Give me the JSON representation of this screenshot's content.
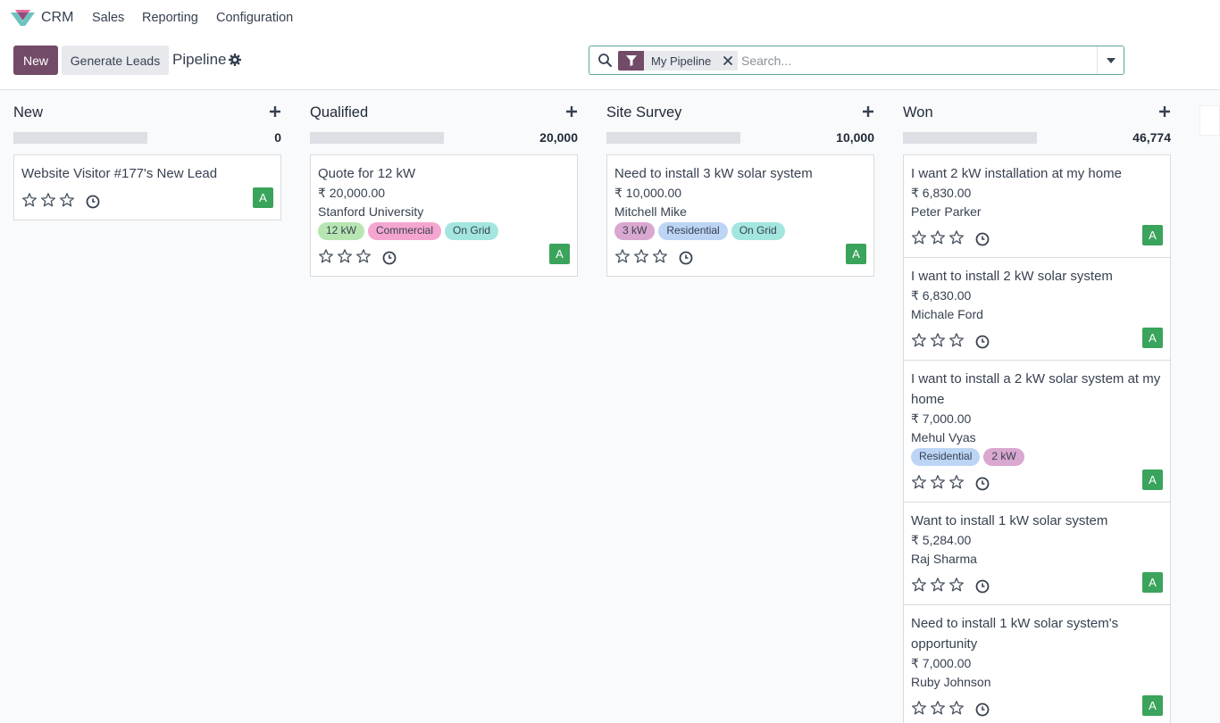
{
  "nav": {
    "app_name": "CRM",
    "menu": [
      "Sales",
      "Reporting",
      "Configuration"
    ]
  },
  "control": {
    "new_label": "New",
    "generate_label": "Generate Leads",
    "breadcrumb": "Pipeline",
    "search": {
      "facet": "My Pipeline",
      "placeholder": "Search..."
    }
  },
  "colors": {
    "brand": "#714B67",
    "avatar": "#3aa35c",
    "tag_green": "#b7e6b3",
    "tag_pink": "#f5a6d0",
    "tag_teal": "#a3e6df",
    "tag_purple": "#d9a7d0",
    "tag_blue": "#bdd5f5"
  },
  "columns": [
    {
      "title": "New",
      "total": "0",
      "cards": [
        {
          "title": "Website Visitor #177's New Lead",
          "amount": "",
          "customer": "",
          "tags": [],
          "avatar": "A"
        }
      ]
    },
    {
      "title": "Qualified",
      "total": "20,000",
      "cards": [
        {
          "title": "Quote for 12 kW",
          "amount": "₹ 20,000.00",
          "customer": "Stanford University",
          "tags": [
            {
              "label": "12 kW",
              "color": "#b7e6b3"
            },
            {
              "label": "Commercial",
              "color": "#f5a6d0"
            },
            {
              "label": "On Grid",
              "color": "#a3e6df"
            }
          ],
          "avatar": "A"
        }
      ]
    },
    {
      "title": "Site Survey",
      "total": "10,000",
      "cards": [
        {
          "title": "Need to install 3 kW solar system",
          "amount": "₹ 10,000.00",
          "customer": "Mitchell Mike",
          "tags": [
            {
              "label": "3 kW",
              "color": "#d9a7d0"
            },
            {
              "label": "Residential",
              "color": "#bdd5f5"
            },
            {
              "label": "On Grid",
              "color": "#a3e6df"
            }
          ],
          "avatar": "A"
        }
      ]
    },
    {
      "title": "Won",
      "total": "46,774",
      "cards": [
        {
          "title": "I want 2 kW installation at my home",
          "amount": "₹ 6,830.00",
          "customer": "Peter Parker",
          "tags": [],
          "avatar": "A"
        },
        {
          "title": "I want to install 2 kW solar system",
          "amount": "₹ 6,830.00",
          "customer": "Michale Ford",
          "tags": [],
          "avatar": "A"
        },
        {
          "title": "I want to install a 2 kW solar system at my home",
          "amount": "₹ 7,000.00",
          "customer": "Mehul Vyas",
          "tags": [
            {
              "label": "Residential",
              "color": "#bdd5f5"
            },
            {
              "label": "2 kW",
              "color": "#d9a7d0"
            }
          ],
          "avatar": "A"
        },
        {
          "title": "Want to install 1 kW solar system",
          "amount": "₹ 5,284.00",
          "customer": "Raj Sharma",
          "tags": [],
          "avatar": "A"
        },
        {
          "title": "Need to install 1 kW solar system's opportunity",
          "amount": "₹ 7,000.00",
          "customer": "Ruby Johnson",
          "tags": [],
          "avatar": "A"
        }
      ]
    }
  ]
}
